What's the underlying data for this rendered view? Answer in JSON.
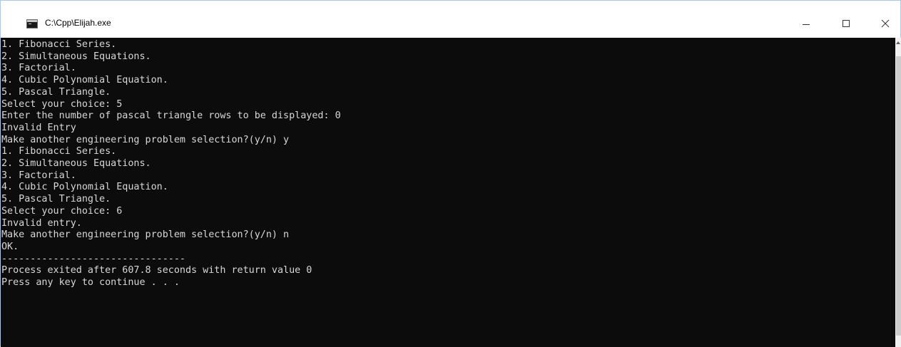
{
  "window": {
    "title": "C:\\Cpp\\Elijah.exe",
    "icon": "console-app-icon",
    "controls": [
      "minimize-icon",
      "maximize-icon",
      "close-icon"
    ]
  },
  "console": {
    "background": "#0c0c0c",
    "foreground": "#d8d8d8",
    "lines": [
      "1. Fibonacci Series.",
      "2. Simultaneous Equations.",
      "3. Factorial.",
      "4. Cubic Polynomial Equation.",
      "5. Pascal Triangle.",
      "Select your choice: 5",
      "Enter the number of pascal triangle rows to be displayed: 0",
      "Invalid Entry",
      "Make another engineering problem selection?(y/n) y",
      "1. Fibonacci Series.",
      "2. Simultaneous Equations.",
      "3. Factorial.",
      "4. Cubic Polynomial Equation.",
      "5. Pascal Triangle.",
      "Select your choice: 6",
      "Invalid entry.",
      "Make another engineering problem selection?(y/n) n",
      "OK.",
      "--------------------------------",
      "Process exited after 607.8 seconds with return value 0",
      "Press any key to continue . . ."
    ]
  }
}
